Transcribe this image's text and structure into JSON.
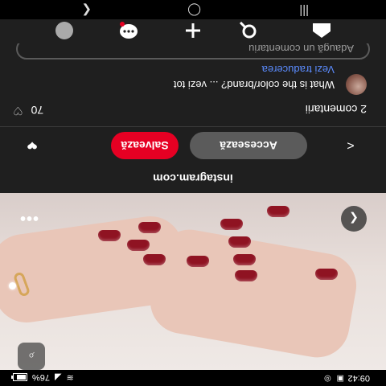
{
  "status_bar": {
    "time": "09:42",
    "battery_percent": "76%",
    "battery_level": 0.76
  },
  "pin": {
    "source": "instagram.com",
    "visit_label": "Accesează",
    "save_label": "Salvează"
  },
  "comments": {
    "count_label": "2 comentarii",
    "likes_count": "70",
    "items": [
      {
        "text": "What is the color/brand? ... vezi tot"
      }
    ],
    "translate_label": "Vezi traducerea",
    "add_placeholder": "Adaugă un comentariu"
  },
  "icons": {
    "share": "share-icon",
    "lens": "lens-icon",
    "heart": "heart-icon",
    "more": "more-icon",
    "expand": "chevron-right-icon",
    "back": "chevron-left-icon"
  },
  "colors": {
    "save": "#e60023",
    "link": "#5b8cff",
    "nail": "#8f1322"
  }
}
